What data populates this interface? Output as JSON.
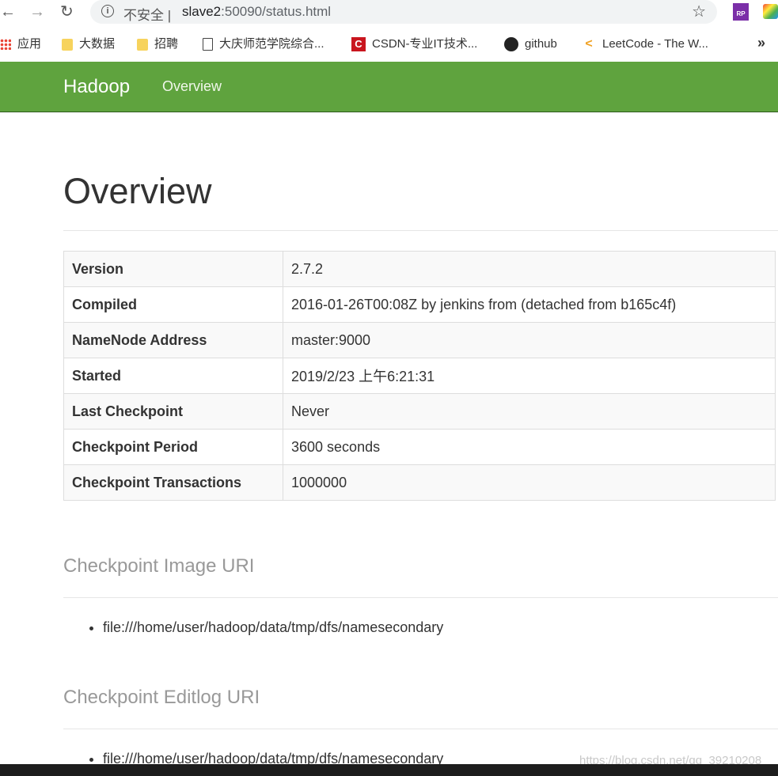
{
  "browser": {
    "security_label": "不安全",
    "url_host": "slave2",
    "url_rest": ":50090/status.html",
    "bookmarks": [
      {
        "label": "应用",
        "icon": "apps-grid-icon"
      },
      {
        "label": "大数据",
        "icon": "folder-icon"
      },
      {
        "label": "招聘",
        "icon": "folder-icon"
      },
      {
        "label": "大庆师范学院综合...",
        "icon": "page-icon"
      },
      {
        "label": "CSDN-专业IT技术...",
        "icon": "csdn-icon"
      },
      {
        "label": "github",
        "icon": "github-icon"
      },
      {
        "label": "LeetCode - The W...",
        "icon": "leetcode-icon"
      }
    ],
    "ext1_label": "RP"
  },
  "navbar": {
    "brand": "Hadoop",
    "link": "Overview"
  },
  "page": {
    "title": "Overview",
    "overview_table": [
      {
        "key": "Version",
        "value": "2.7.2"
      },
      {
        "key": "Compiled",
        "value": "2016-01-26T00:08Z by jenkins from (detached from b165c4f)"
      },
      {
        "key": "NameNode Address",
        "value": "master:9000"
      },
      {
        "key": "Started",
        "value": "2019/2/23 上午6:21:31"
      },
      {
        "key": "Last Checkpoint",
        "value": "Never"
      },
      {
        "key": "Checkpoint Period",
        "value": "3600 seconds"
      },
      {
        "key": "Checkpoint Transactions",
        "value": "1000000"
      }
    ],
    "image_uri_heading": "Checkpoint Image URI",
    "image_uris": [
      "file:///home/user/hadoop/data/tmp/dfs/namesecondary"
    ],
    "editlog_uri_heading": "Checkpoint Editlog URI",
    "editlog_uris": [
      "file:///home/user/hadoop/data/tmp/dfs/namesecondary"
    ]
  },
  "watermark": "https://blog.csdn.net/qq_39210208"
}
